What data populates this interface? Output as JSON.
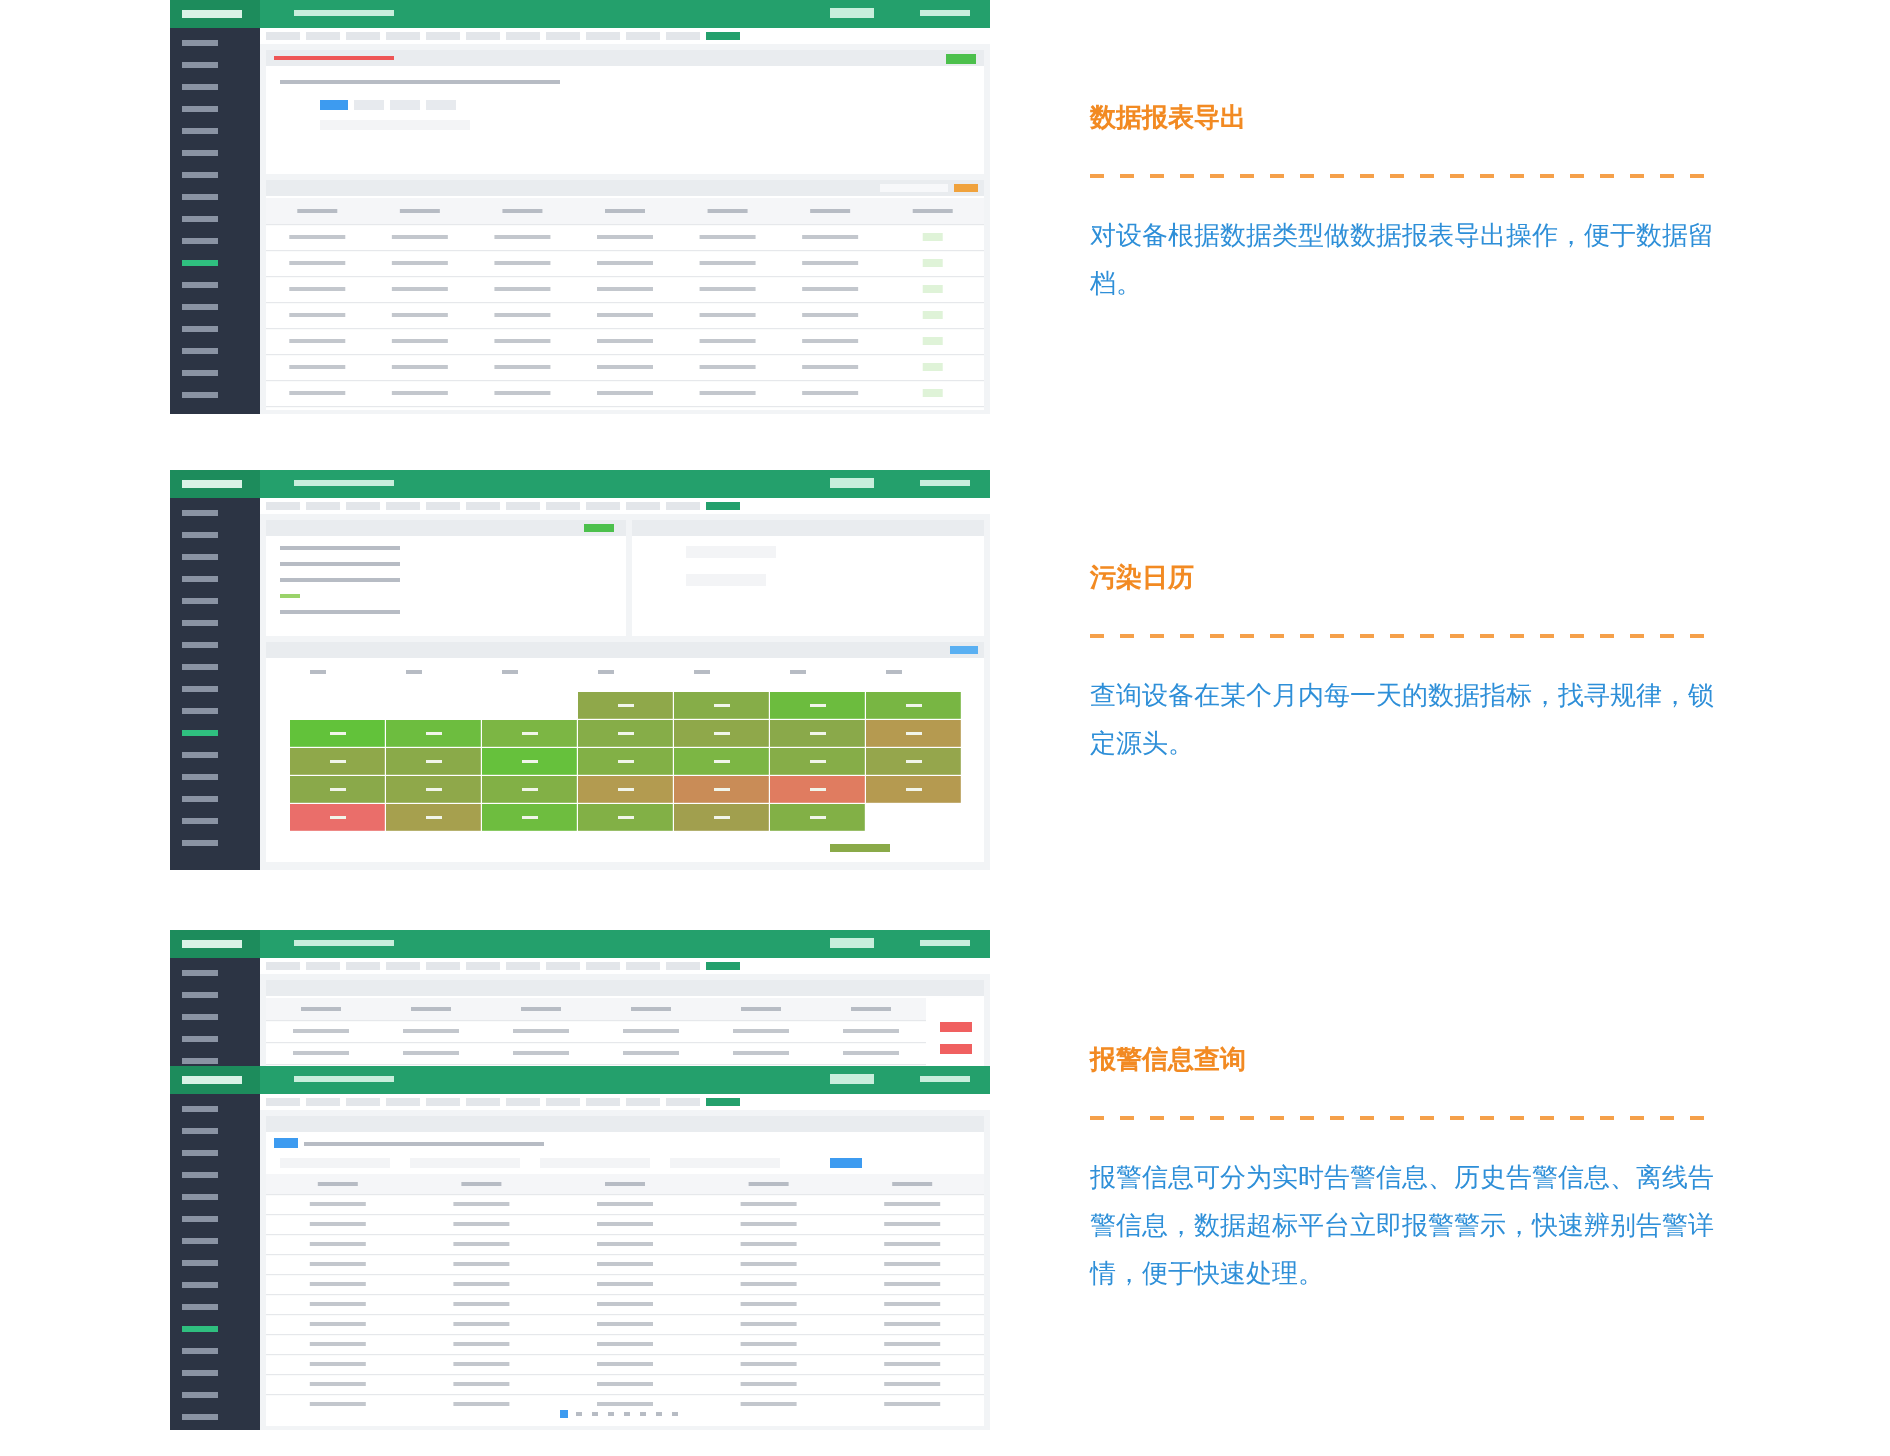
{
  "sections": [
    {
      "screenshot": {
        "kind": "table"
      },
      "title": "数据报表导出",
      "description": "对设备根据数据类型做数据报表导出操作，便于数据留档。"
    },
    {
      "screenshot": {
        "kind": "calendar"
      },
      "title": "污染日历",
      "description": "查询设备在某个月内每一天的数据指标，找寻规律，锁定源头。"
    },
    {
      "screenshot": {
        "kind": "alerts"
      },
      "title": "报警信息查询",
      "description": "报警信息可分为实时告警信息、历史告警信息、离线告警信息，数据超标平台立即报警警示，快速辨别告警详情，便于快速处理。"
    }
  ]
}
